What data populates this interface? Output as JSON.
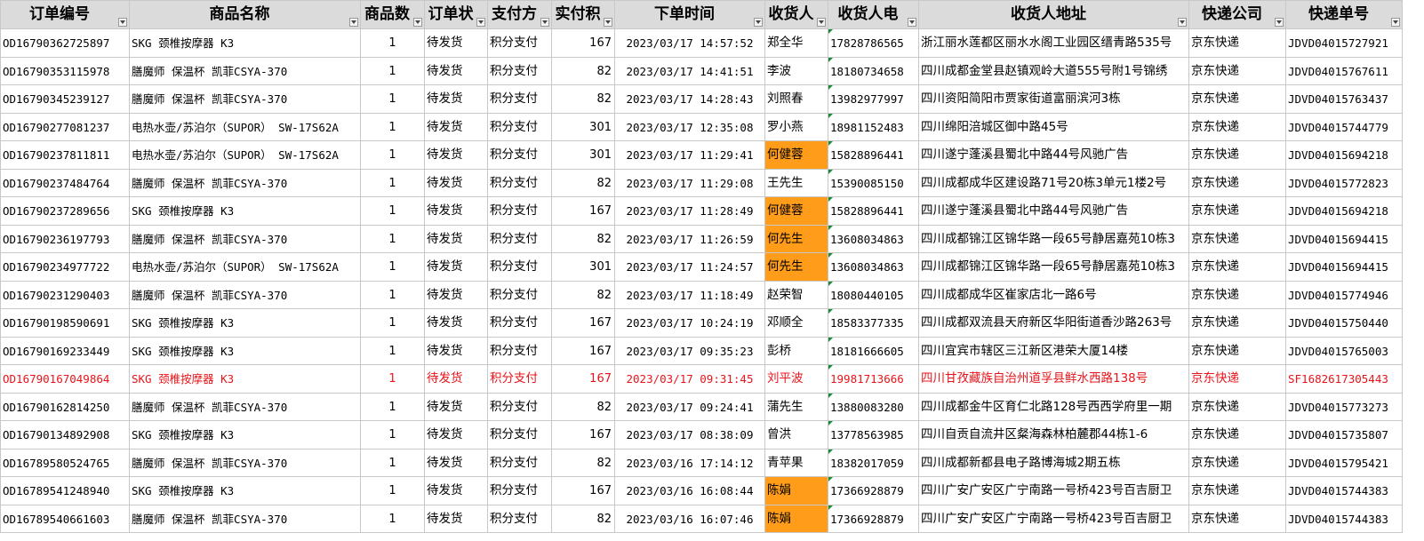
{
  "colors": {
    "highlight": "#ff9c1a",
    "alert_text": "#e8141a",
    "header_bg": "#dbdbdb",
    "comment_marker": "#1a8a3a"
  },
  "headers": [
    "订单编号",
    "商品名称",
    "商品数",
    "订单状",
    "支付方",
    "实付积",
    "下单时间",
    "收货人",
    "收货人电",
    "收货人地址",
    "快递公司",
    "快递单号"
  ],
  "rows": [
    {
      "order": "OD16790362725897",
      "product": "SKG 颈椎按摩器 K3",
      "qty": "1",
      "status": "待发货",
      "pay": "积分支付",
      "points": "167",
      "time": "2023/03/17 14:57:52",
      "name": "郑全华",
      "phone": "17828786565",
      "addr": "浙江丽水莲都区丽水水阁工业园区缙青路535号",
      "courier": "京东快递",
      "track": "JDVD04015727921",
      "highlight": false,
      "red": false
    },
    {
      "order": "OD16790353115978",
      "product": "膳魔师 保温杯 凯菲CSYA-370",
      "qty": "1",
      "status": "待发货",
      "pay": "积分支付",
      "points": "82",
      "time": "2023/03/17 14:41:51",
      "name": "李波",
      "phone": "18180734658",
      "addr": "四川成都金堂县赵镇观岭大道555号附1号锦绣",
      "courier": "京东快递",
      "track": "JDVD04015767611",
      "highlight": false,
      "red": false
    },
    {
      "order": "OD16790345239127",
      "product": "膳魔师 保温杯 凯菲CSYA-370",
      "qty": "1",
      "status": "待发货",
      "pay": "积分支付",
      "points": "82",
      "time": "2023/03/17 14:28:43",
      "name": "刘照春",
      "phone": "13982977997",
      "addr": "四川资阳简阳市贾家街道富丽滨河3栋",
      "courier": "京东快递",
      "track": "JDVD04015763437",
      "highlight": false,
      "red": false
    },
    {
      "order": "OD16790277081237",
      "product": "电热水壶/苏泊尔（SUPOR） SW-17S62A",
      "qty": "1",
      "status": "待发货",
      "pay": "积分支付",
      "points": "301",
      "time": "2023/03/17 12:35:08",
      "name": "罗小燕",
      "phone": "18981152483",
      "addr": "四川绵阳涪城区御中路45号",
      "courier": "京东快递",
      "track": "JDVD04015744779",
      "highlight": false,
      "red": false
    },
    {
      "order": "OD16790237811811",
      "product": "电热水壶/苏泊尔（SUPOR） SW-17S62A",
      "qty": "1",
      "status": "待发货",
      "pay": "积分支付",
      "points": "301",
      "time": "2023/03/17 11:29:41",
      "name": "何健蓉",
      "phone": "15828896441",
      "addr": "四川遂宁蓬溪县蜀北中路44号风驰广告",
      "courier": "京东快递",
      "track": "JDVD04015694218",
      "highlight": true,
      "red": false
    },
    {
      "order": "OD16790237484764",
      "product": "膳魔师 保温杯 凯菲CSYA-370",
      "qty": "1",
      "status": "待发货",
      "pay": "积分支付",
      "points": "82",
      "time": "2023/03/17 11:29:08",
      "name": "王先生",
      "phone": "15390085150",
      "addr": "四川成都成华区建设路71号20栋3单元1楼2号",
      "courier": "京东快递",
      "track": "JDVD04015772823",
      "highlight": false,
      "red": false
    },
    {
      "order": "OD16790237289656",
      "product": "SKG 颈椎按摩器 K3",
      "qty": "1",
      "status": "待发货",
      "pay": "积分支付",
      "points": "167",
      "time": "2023/03/17 11:28:49",
      "name": "何健蓉",
      "phone": "15828896441",
      "addr": "四川遂宁蓬溪县蜀北中路44号风驰广告",
      "courier": "京东快递",
      "track": "JDVD04015694218",
      "highlight": true,
      "red": false
    },
    {
      "order": "OD16790236197793",
      "product": "膳魔师 保温杯 凯菲CSYA-370",
      "qty": "1",
      "status": "待发货",
      "pay": "积分支付",
      "points": "82",
      "time": "2023/03/17 11:26:59",
      "name": "何先生",
      "phone": "13608034863",
      "addr": "四川成都锦江区锦华路一段65号静居嘉苑10栋3",
      "courier": "京东快递",
      "track": "JDVD04015694415",
      "highlight": true,
      "red": false
    },
    {
      "order": "OD16790234977722",
      "product": "电热水壶/苏泊尔（SUPOR） SW-17S62A",
      "qty": "1",
      "status": "待发货",
      "pay": "积分支付",
      "points": "301",
      "time": "2023/03/17 11:24:57",
      "name": "何先生",
      "phone": "13608034863",
      "addr": "四川成都锦江区锦华路一段65号静居嘉苑10栋3",
      "courier": "京东快递",
      "track": "JDVD04015694415",
      "highlight": true,
      "red": false
    },
    {
      "order": "OD16790231290403",
      "product": "膳魔师 保温杯 凯菲CSYA-370",
      "qty": "1",
      "status": "待发货",
      "pay": "积分支付",
      "points": "82",
      "time": "2023/03/17 11:18:49",
      "name": "赵荣智",
      "phone": "18080440105",
      "addr": "四川成都成华区崔家店北一路6号",
      "courier": "京东快递",
      "track": "JDVD04015774946",
      "highlight": false,
      "red": false
    },
    {
      "order": "OD16790198590691",
      "product": "SKG 颈椎按摩器 K3",
      "qty": "1",
      "status": "待发货",
      "pay": "积分支付",
      "points": "167",
      "time": "2023/03/17 10:24:19",
      "name": "邓顺全",
      "phone": "18583377335",
      "addr": "四川成都双流县天府新区华阳街道香沙路263号",
      "courier": "京东快递",
      "track": "JDVD04015750440",
      "highlight": false,
      "red": false
    },
    {
      "order": "OD16790169233449",
      "product": "SKG 颈椎按摩器 K3",
      "qty": "1",
      "status": "待发货",
      "pay": "积分支付",
      "points": "167",
      "time": "2023/03/17 09:35:23",
      "name": "彭桥",
      "phone": "18181666605",
      "addr": "四川宜宾市辖区三江新区港荣大厦14楼",
      "courier": "京东快递",
      "track": "JDVD04015765003",
      "highlight": false,
      "red": false
    },
    {
      "order": "OD16790167049864",
      "product": "SKG 颈椎按摩器 K3",
      "qty": "1",
      "status": "待发货",
      "pay": "积分支付",
      "points": "167",
      "time": "2023/03/17 09:31:45",
      "name": "刘平波",
      "phone": "19981713666",
      "addr": "四川甘孜藏族自治州道孚县鲜水西路138号",
      "courier": "京东快递",
      "track": "SF1682617305443",
      "highlight": false,
      "red": true
    },
    {
      "order": "OD16790162814250",
      "product": "膳魔师 保温杯 凯菲CSYA-370",
      "qty": "1",
      "status": "待发货",
      "pay": "积分支付",
      "points": "82",
      "time": "2023/03/17 09:24:41",
      "name": "蒲先生",
      "phone": "13880083280",
      "addr": "四川成都金牛区育仁北路128号西西学府里一期",
      "courier": "京东快递",
      "track": "JDVD04015773273",
      "highlight": false,
      "red": false
    },
    {
      "order": "OD16790134892908",
      "product": "SKG 颈椎按摩器 K3",
      "qty": "1",
      "status": "待发货",
      "pay": "积分支付",
      "points": "167",
      "time": "2023/03/17 08:38:09",
      "name": "曾洪",
      "phone": "13778563985",
      "addr": "四川自贡自流井区粲海森林柏麓郡44栋1-6",
      "courier": "京东快递",
      "track": "JDVD04015735807",
      "highlight": false,
      "red": false
    },
    {
      "order": "OD16789580524765",
      "product": "膳魔师 保温杯 凯菲CSYA-370",
      "qty": "1",
      "status": "待发货",
      "pay": "积分支付",
      "points": "82",
      "time": "2023/03/16 17:14:12",
      "name": "青苹果",
      "phone": "18382017059",
      "addr": "四川成都新都县电子路博海城2期五栋",
      "courier": "京东快递",
      "track": "JDVD04015795421",
      "highlight": false,
      "red": false
    },
    {
      "order": "OD16789541248940",
      "product": "SKG 颈椎按摩器 K3",
      "qty": "1",
      "status": "待发货",
      "pay": "积分支付",
      "points": "167",
      "time": "2023/03/16 16:08:44",
      "name": "陈娟",
      "phone": "17366928879",
      "addr": "四川广安广安区广宁南路一号桥423号百吉厨卫",
      "courier": "京东快递",
      "track": "JDVD04015744383",
      "highlight": true,
      "red": false
    },
    {
      "order": "OD16789540661603",
      "product": "膳魔师 保温杯 凯菲CSYA-370",
      "qty": "1",
      "status": "待发货",
      "pay": "积分支付",
      "points": "82",
      "time": "2023/03/16 16:07:46",
      "name": "陈娟",
      "phone": "17366928879",
      "addr": "四川广安广安区广宁南路一号桥423号百吉厨卫",
      "courier": "京东快递",
      "track": "JDVD04015744383",
      "highlight": true,
      "red": false
    }
  ]
}
